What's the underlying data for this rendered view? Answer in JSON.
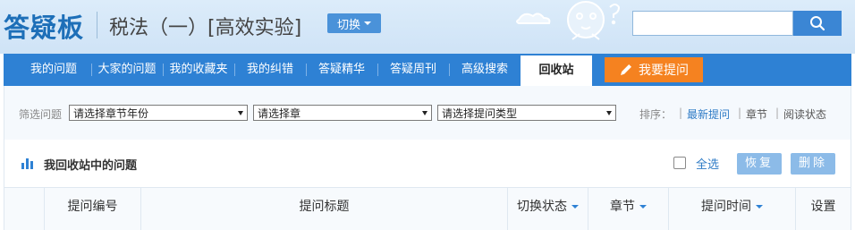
{
  "header": {
    "logo": "答疑板",
    "course": "税法（一）[高效实验]",
    "switch_label": "切换",
    "search": {
      "placeholder": "",
      "value": ""
    }
  },
  "nav": {
    "items": [
      "我的问题",
      "大家的问题",
      "我的收藏夹",
      "我的纠错",
      "答疑精华",
      "答疑周刊",
      "高级搜索",
      "回收站"
    ],
    "active": "回收站",
    "ask_label": "我要提问"
  },
  "filter": {
    "label": "筛选问题",
    "selects": [
      "请选择章节年份",
      "请选择章",
      "请选择提问类型"
    ],
    "sort_label": "排序：",
    "sort_options": [
      "最新提问",
      "章节",
      "阅读状态"
    ]
  },
  "list": {
    "title": "我回收站中的问题",
    "select_all": "全选",
    "restore": "恢复",
    "delete": "删除"
  },
  "table": {
    "columns": [
      "提问编号",
      "提问标题",
      "切换状态",
      "章节",
      "提问时间",
      "设置"
    ]
  },
  "colors": {
    "nav": "#2e81d4",
    "accent_orange": "#f58220",
    "logo": "#1d6fb8"
  }
}
